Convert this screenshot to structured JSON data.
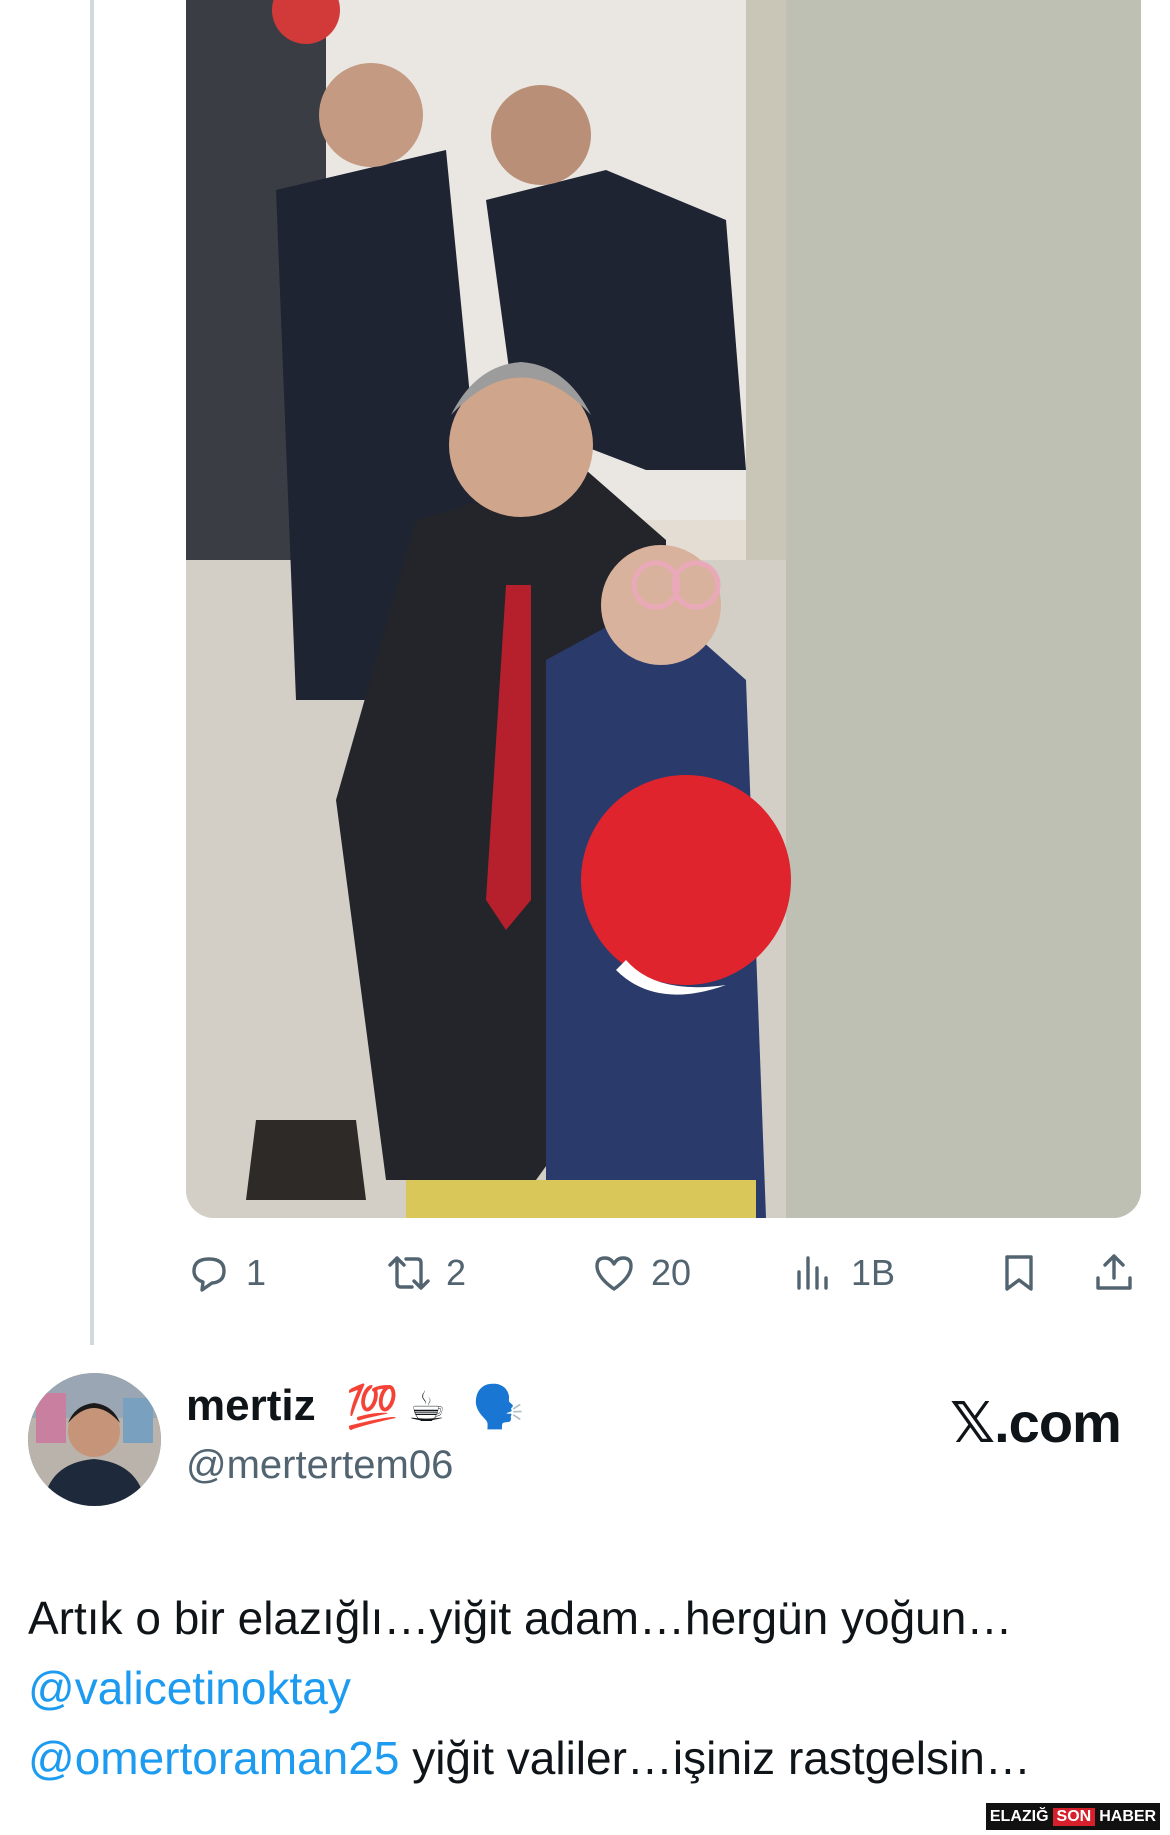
{
  "post": {
    "actions": {
      "replies": "1",
      "reposts": "2",
      "likes": "20",
      "views": "1B"
    },
    "media_alt": "Photo: official in dark suit crouching beside a girl holding a red balloon, officials standing behind"
  },
  "author": {
    "display_name": "mertiz",
    "emojis": [
      "💯",
      "☕",
      "🗣️"
    ],
    "handle": "@mertertem06"
  },
  "branding": {
    "site": "𝕏.com",
    "watermark_left": "ELAZIĞ",
    "watermark_mid": "SON",
    "watermark_right": "HABER"
  },
  "tweet": {
    "line1": "Artık o bir elazığlı…yiğit adam…hergün yoğun…",
    "mention1": "@valicetinoktay",
    "mention2": "@omertoraman25",
    "line3_rest": " yiğit valiler…işiniz rastgelsin…"
  },
  "colors": {
    "link": "#1d9bf0",
    "muted": "#536471",
    "text": "#0f1419",
    "thread_line": "#cfd9de"
  }
}
